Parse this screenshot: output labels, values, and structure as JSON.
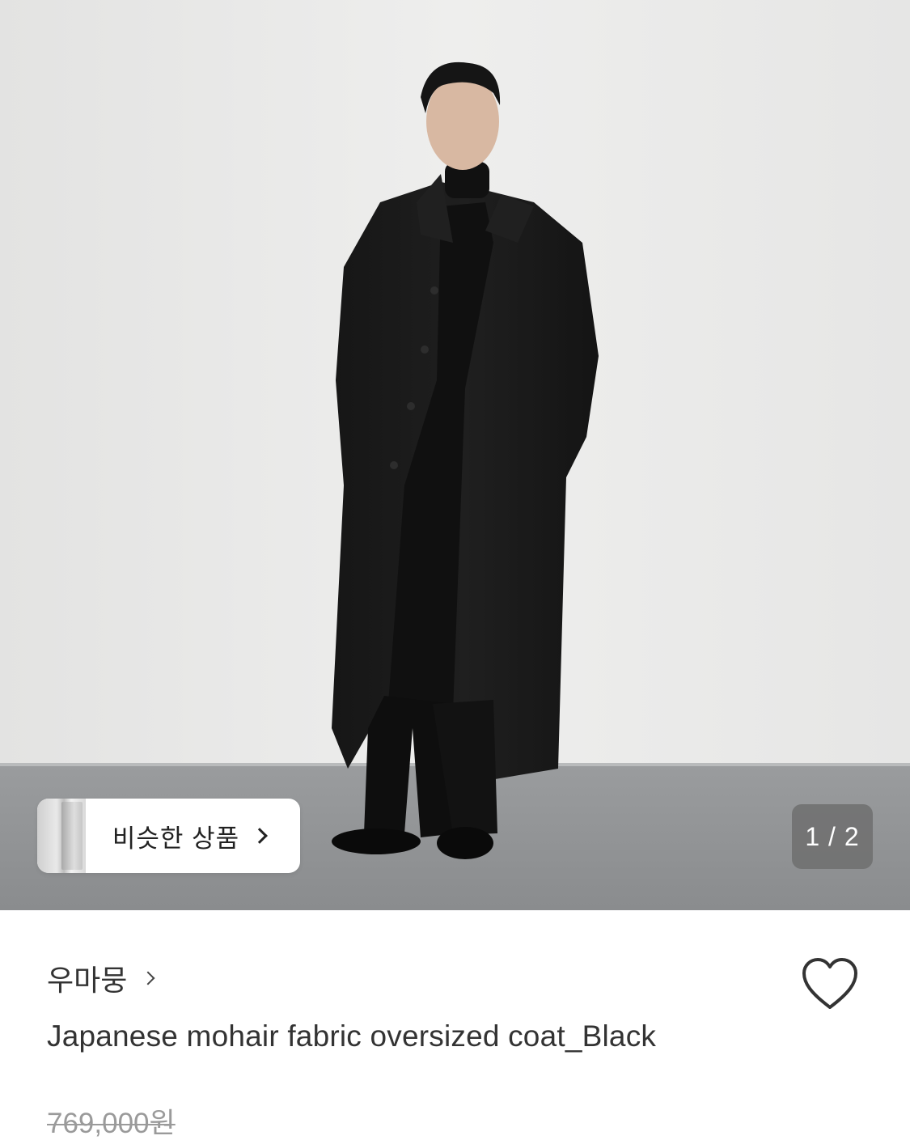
{
  "gallery": {
    "image_subject": "model-in-black-oversized-coat",
    "counter_text": "1 / 2",
    "similar_button_label": "비슷한 상품"
  },
  "product": {
    "brand": "우마뭉",
    "title": "Japanese mohair fabric oversized coat_Black",
    "original_price": "769,000원"
  },
  "icons": {
    "similar_arrow": "chevron-right-icon",
    "brand_arrow": "chevron-right-icon",
    "wishlist": "heart-outline-icon"
  },
  "colors": {
    "background_wall": "#e9e9e8",
    "floor": "#8d8f91",
    "counter_bg": "#6e6e6e",
    "price_gray": "#9a9a9a"
  }
}
